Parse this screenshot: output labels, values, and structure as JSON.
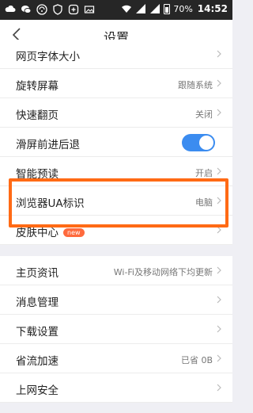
{
  "statusbar": {
    "left_icons": [
      "cloud-icon",
      "chat-icon",
      "wifi-icon",
      "shield-icon",
      "sync-icon",
      "image-icon"
    ],
    "battery": "70%",
    "time": "14:52"
  },
  "header": {
    "title": "设置"
  },
  "rows_top": [
    {
      "label": "网页字体大小",
      "value": "",
      "type": "chevron"
    },
    {
      "label": "旋转屏幕",
      "value": "跟随系统",
      "type": "chevron"
    },
    {
      "label": "快速翻页",
      "value": "关闭",
      "type": "chevron"
    },
    {
      "label": "滑屏前进后退",
      "value": "",
      "type": "toggle",
      "on": true
    },
    {
      "label": "智能预读",
      "value": "开启",
      "type": "chevron"
    },
    {
      "label": "浏览器UA标识",
      "value": "电脑",
      "type": "chevron"
    },
    {
      "label": "皮肤中心",
      "badge": "new",
      "value": "",
      "type": "chevron"
    }
  ],
  "rows_bottom": [
    {
      "label": "主页资讯",
      "value": "Wi-Fi及移动网络下均更新",
      "type": "chevron"
    },
    {
      "label": "消息管理",
      "value": "",
      "type": "chevron"
    },
    {
      "label": "下载设置",
      "value": "",
      "type": "chevron"
    },
    {
      "label": "省流加速",
      "value": "已省 0B",
      "type": "chevron"
    },
    {
      "label": "上网安全",
      "value": "",
      "type": "chevron"
    }
  ],
  "colors": {
    "accent": "#3b8cf0",
    "highlight": "#ff6a15"
  }
}
